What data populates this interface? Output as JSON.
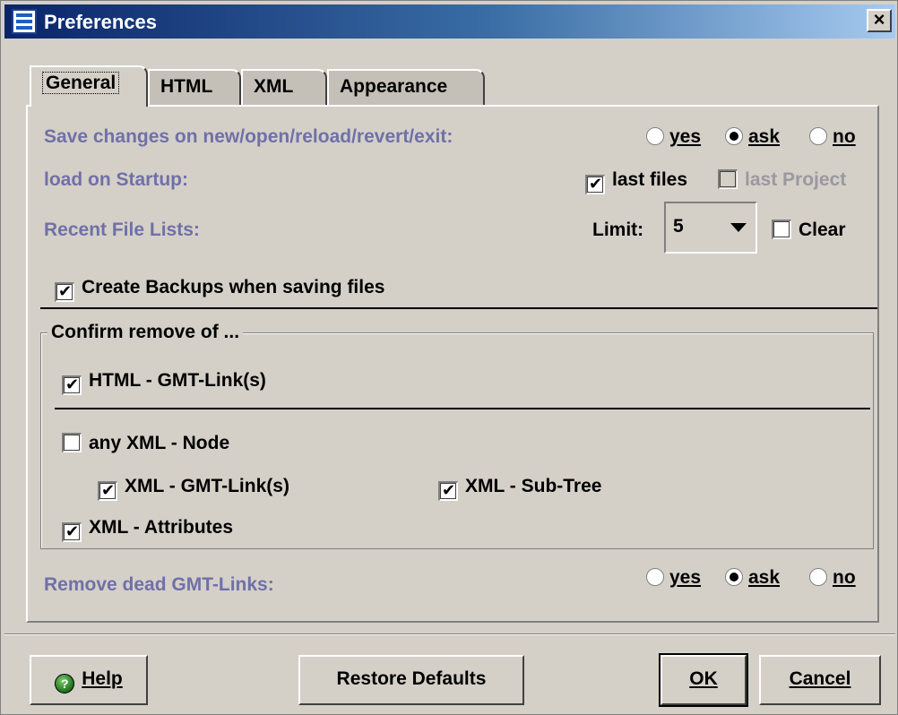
{
  "window": {
    "title": "Preferences",
    "close_label": "×"
  },
  "tabs": [
    {
      "label": "General",
      "active": true
    },
    {
      "label": "HTML",
      "active": false
    },
    {
      "label": "XML",
      "active": false
    },
    {
      "label": "Appearance",
      "active": false
    }
  ],
  "general": {
    "save_changes": {
      "label": "Save changes on new/open/reload/revert/exit:",
      "options": [
        "yes",
        "ask",
        "no"
      ],
      "selected": "ask"
    },
    "load_on_startup": {
      "label": "load on Startup:",
      "last_files": {
        "label": "last files",
        "checked": true
      },
      "last_project": {
        "label": "last Project",
        "checked": false,
        "enabled": false
      }
    },
    "recent_files": {
      "label": "Recent File Lists:",
      "limit_label": "Limit:",
      "limit_value": "5",
      "clear": {
        "label": "Clear",
        "checked": false
      }
    },
    "create_backups": {
      "label": "Create Backups when saving files",
      "checked": true
    },
    "confirm_remove": {
      "title": "Confirm remove of ...",
      "html_gmt_links": {
        "label": "HTML - GMT-Link(s)",
        "checked": true
      },
      "any_xml_node": {
        "label": "any XML - Node",
        "checked": false
      },
      "xml_gmt_links": {
        "label": "XML - GMT-Link(s)",
        "checked": true
      },
      "xml_sub_tree": {
        "label": "XML - Sub-Tree",
        "checked": true
      },
      "xml_attributes": {
        "label": "XML - Attributes",
        "checked": true
      }
    },
    "remove_dead_links": {
      "label": "Remove dead GMT-Links:",
      "options": [
        "yes",
        "ask",
        "no"
      ],
      "selected": "ask"
    }
  },
  "buttons": {
    "help": "Help",
    "restore_defaults": "Restore Defaults",
    "ok": "OK",
    "cancel": "Cancel"
  },
  "colors": {
    "title_gradient_start": "#0a246a",
    "title_gradient_end": "#a6caf0",
    "label_blue": "#7070a8",
    "dialog_bg": "#d4d0c8"
  }
}
